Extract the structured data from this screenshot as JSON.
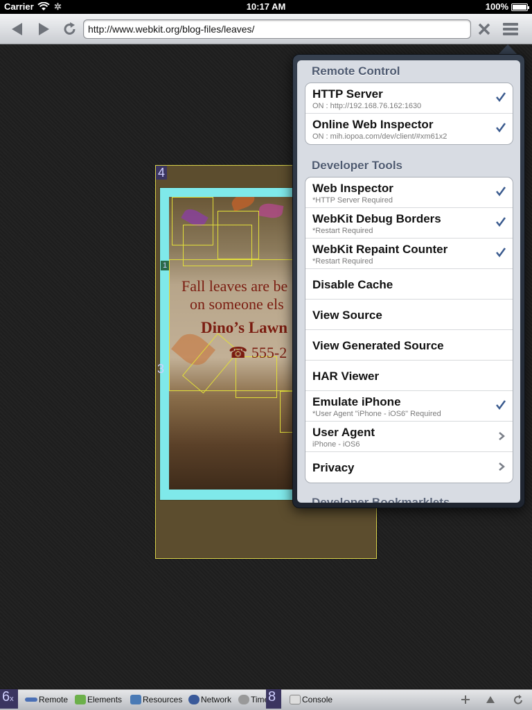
{
  "status_bar": {
    "carrier": "Carrier",
    "time": "10:17 AM",
    "battery": "100%"
  },
  "toolbar": {
    "url": "http://www.webkit.org/blog-files/leaves/",
    "back_icon": "back-arrow-icon",
    "forward_icon": "forward-arrow-icon",
    "reload_icon": "reload-icon",
    "stop_icon": "close-icon",
    "menu_icon": "menu-icon"
  },
  "page": {
    "poster_line1": "Fall leaves are be",
    "poster_line2": "on someone els",
    "poster_line3": "Dino’s Lawn",
    "poster_phone": "555-2",
    "debug_label_4": "4",
    "debug_label_1": "1",
    "debug_label_3": "3"
  },
  "popover": {
    "remote_control_header": "Remote Control",
    "remote_items": [
      {
        "title": "HTTP Server",
        "subtitle": "ON : http://192.168.76.162:1630",
        "checked": true
      },
      {
        "title": "Online Web Inspector",
        "subtitle": "ON : mih.iopoa.com/dev/client/#xm61x2",
        "checked": true
      }
    ],
    "developer_tools_header": "Developer Tools",
    "dev_items": [
      {
        "title": "Web Inspector",
        "subtitle": "*HTTP Server  Required",
        "checked": true
      },
      {
        "title": "WebKit Debug Borders",
        "subtitle": "*Restart Required",
        "checked": true
      },
      {
        "title": "WebKit Repaint Counter",
        "subtitle": "*Restart Required",
        "checked": true
      },
      {
        "title": "Disable Cache"
      },
      {
        "title": "View Source"
      },
      {
        "title": "View Generated Source"
      },
      {
        "title": "HAR Viewer"
      },
      {
        "title": "Emulate iPhone",
        "subtitle": "*User Agent \"iPhone - iOS6\" Required",
        "checked": true
      },
      {
        "title": "User Agent",
        "subtitle": "iPhone - iOS6",
        "chevron": true
      },
      {
        "title": "Privacy",
        "chevron": true
      }
    ],
    "bookmarklets_header": "Developer Bookmarklets"
  },
  "bottom_bar": {
    "remote": "Remote",
    "elements": "Elements",
    "resources": "Resources",
    "network": "Network",
    "timeline": "Time",
    "timeline_tail": "e",
    "console": "Console",
    "label_6": "6",
    "label_x": "x",
    "label_8": "8",
    "plus_icon": "plus-icon",
    "up_icon": "triangle-up-icon",
    "refresh_icon": "refresh-icon"
  },
  "colors": {
    "checkmark": "#3a5a8e",
    "section_header": "#4e5a70",
    "debug_border": "#e2df3a"
  }
}
